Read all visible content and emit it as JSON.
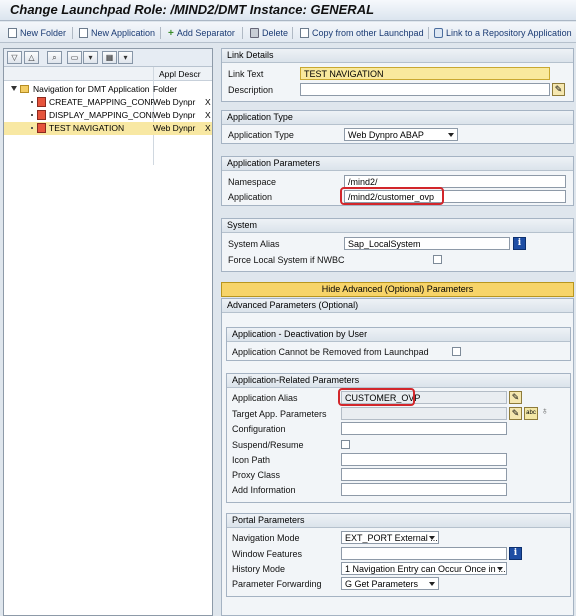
{
  "title": "Change Launchpad Role: /MIND2/DMT Instance: GENERAL",
  "toolbar": {
    "new_folder": "New Folder",
    "new_application": "New Application",
    "add_separator": "Add Separator",
    "delete": "Delete",
    "copy_other": "Copy from other Launchpad",
    "link_repo": "Link to a Repository Application"
  },
  "tree": {
    "col_appl_descr": "Appl Descr",
    "root": {
      "name": "Navigation for DMT Application",
      "type": "Folder"
    },
    "items": [
      {
        "name": "CREATE_MAPPING_CONFI",
        "type": "Web Dynpr",
        "x": "X"
      },
      {
        "name": "DISPLAY_MAPPING_CONFI",
        "type": "Web Dynpr",
        "x": "X"
      },
      {
        "name": "TEST NAVIGATION",
        "type": "Web Dynpr",
        "x": "X"
      }
    ]
  },
  "link_details": {
    "header": "Link Details",
    "link_text_label": "Link Text",
    "link_text": "TEST NAVIGATION",
    "description_label": "Description",
    "description": ""
  },
  "app_type": {
    "header": "Application Type",
    "label": "Application Type",
    "value": "Web Dynpro ABAP"
  },
  "app_params": {
    "header": "Application Parameters",
    "namespace_label": "Namespace",
    "namespace": "/mind2/",
    "application_label": "Application",
    "application": "/mind2/customer_ovp"
  },
  "system": {
    "header": "System",
    "alias_label": "System Alias",
    "alias": "Sap_LocalSystem",
    "force_label": "Force Local System if NWBC"
  },
  "hide_button": "Hide Advanced (Optional) Parameters",
  "advanced": {
    "header": "Advanced Parameters (Optional)",
    "deactivation": {
      "header": "Application - Deactivation by User",
      "label": "Application Cannot be Removed from Launchpad"
    },
    "related": {
      "header": "Application-Related Parameters",
      "alias_label": "Application Alias",
      "alias": "CUSTOMER_OVP",
      "target_label": "Target App. Parameters",
      "config_label": "Configuration",
      "suspend_label": "Suspend/Resume",
      "icon_label": "Icon Path",
      "proxy_label": "Proxy Class",
      "addinfo_label": "Add Information"
    },
    "portal": {
      "header": "Portal Parameters",
      "nav_mode_label": "Navigation Mode",
      "nav_mode": "EXT_PORT External ...",
      "window_label": "Window Features",
      "history_label": "History Mode",
      "history": "1 Navigation Entry can Occur Once in ...",
      "param_fwd_label": "Parameter Forwarding",
      "param_fwd": "G Get Parameters"
    }
  },
  "colors": {
    "highlight": "#f9e99d",
    "callout": "#d2262b",
    "info": "#1f4ea4"
  }
}
